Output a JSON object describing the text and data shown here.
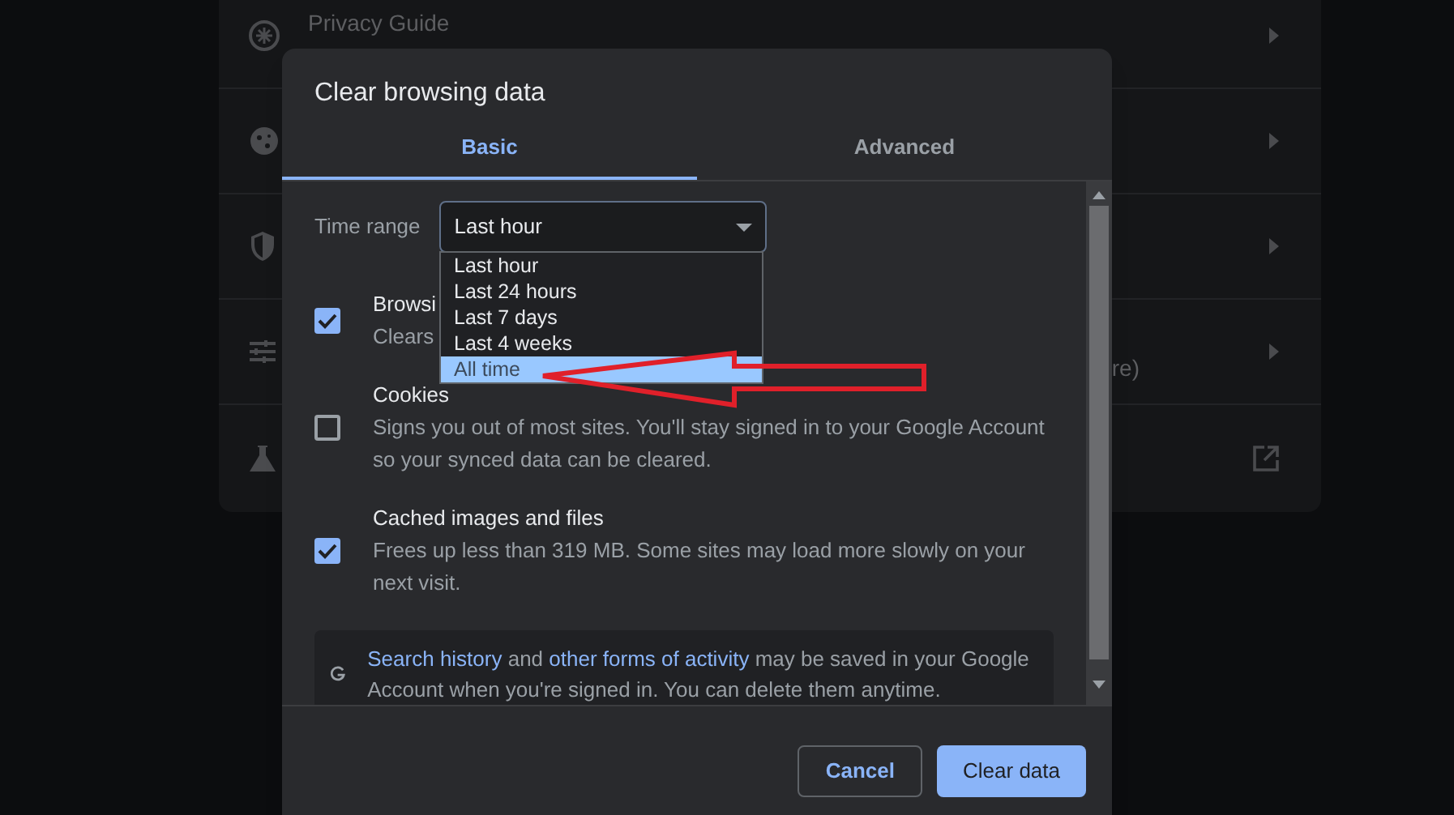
{
  "settings_list": {
    "items": [
      {
        "label": "Privacy Guide",
        "kind": "arrow"
      },
      {
        "kind": "arrow"
      },
      {
        "kind": "arrow"
      },
      {
        "trailing": "re)",
        "kind": "arrow"
      },
      {
        "kind": "external"
      }
    ]
  },
  "dialog": {
    "title": "Clear browsing data",
    "tabs": [
      {
        "label": "Basic",
        "selected": true
      },
      {
        "label": "Advanced",
        "selected": false
      }
    ],
    "time_range": {
      "label": "Time range",
      "value": "Last hour",
      "options": [
        {
          "label": "Last hour",
          "highlighted": false
        },
        {
          "label": "Last 24 hours",
          "highlighted": false
        },
        {
          "label": "Last 7 days",
          "highlighted": false
        },
        {
          "label": "Last 4 weeks",
          "highlighted": false
        },
        {
          "label": "All time",
          "highlighted": true
        }
      ]
    },
    "options": [
      {
        "title": "Browsi",
        "description": "Clears",
        "checked": true
      },
      {
        "title": "Cookies",
        "description": "Signs you out of most sites. You'll stay signed in to your Google Account so your synced data can be cleared.",
        "checked": false
      },
      {
        "title": "Cached images and files",
        "description": "Frees up less than 319 MB. Some sites may load more slowly on your next visit.",
        "checked": true
      }
    ],
    "info": {
      "parts": [
        {
          "text": "Search history",
          "kind": "link"
        },
        {
          "text": " and ",
          "kind": "plain"
        },
        {
          "text": "other forms of activity",
          "kind": "link"
        },
        {
          "text": " may be saved in your Google Account when you're signed in. You can delete them anytime.",
          "kind": "plain"
        }
      ]
    },
    "buttons": [
      {
        "label": "Cancel",
        "kind": "secondary"
      },
      {
        "label": "Clear data",
        "kind": "primary"
      }
    ]
  }
}
